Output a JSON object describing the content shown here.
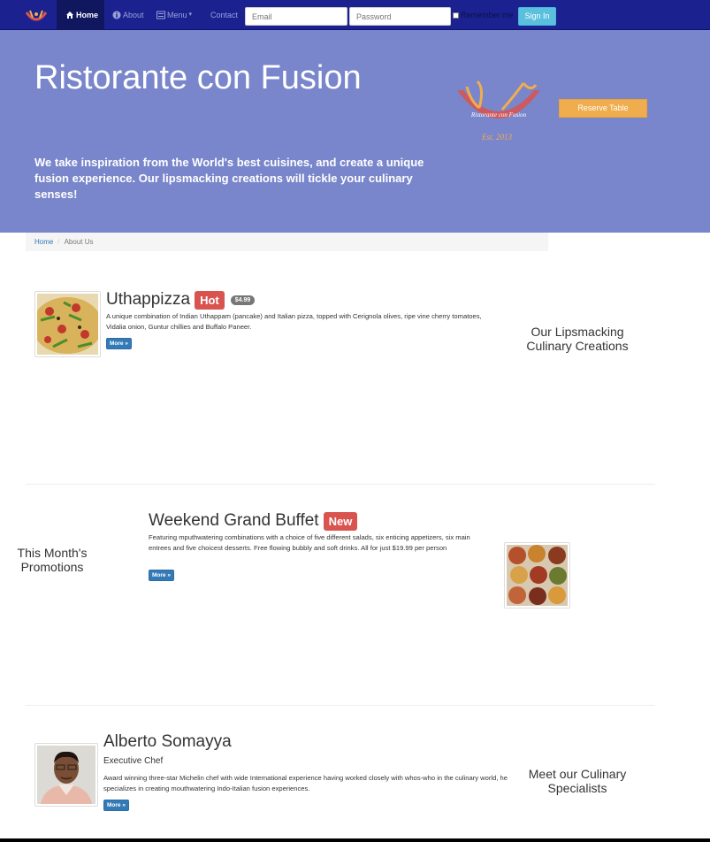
{
  "navbar": {
    "logo_icon": "restaurant-logo-icon",
    "items": [
      {
        "label": "Home",
        "icon": "home-icon",
        "active": true
      },
      {
        "label": "About",
        "icon": "info-icon",
        "active": false
      },
      {
        "label": "Menu",
        "icon": "list-icon",
        "active": false
      },
      {
        "label": "Contact",
        "icon": "",
        "active": false
      }
    ],
    "email_placeholder": "Email",
    "password_placeholder": "Password",
    "remember_label": "Remember me",
    "signin_label": "Sign In"
  },
  "jumbotron": {
    "title": "Ristorante con Fusion",
    "text": "We take inspiration from the World's best cuisines, and create a unique fusion experience. Our lipsmacking creations will tickle your culinary senses!",
    "logo_text": "Ristorante con Fusion",
    "logo_est": "Est. 2013",
    "reserve_label": "Reserve Table"
  },
  "breadcrumb": {
    "home": "Home",
    "current": "About Us"
  },
  "dish": {
    "name": "Uthappizza",
    "label": "Hot",
    "price": "$4.99",
    "description": "A unique combination of Indian Uthappam (pancake) and Italian pizza, topped with Cerignola olives, ripe vine cherry tomatoes, Vidalia onion, Guntur chillies and Buffalo Paneer.",
    "more_label": "More »",
    "side_text": "Our Lipsmacking Culinary Creations",
    "image_icon": "pizza-image"
  },
  "promotion": {
    "name": "Weekend Grand Buffet",
    "label": "New",
    "description": "Featuring mputhwatering combinations with a choice of five different salads, six enticing appetizers, six main entrees and five choicest desserts. Free flowing bubbly and soft drinks. All for just $19.99 per person",
    "more_label": "More »",
    "side_text": "This Month's Promotions",
    "image_icon": "buffet-image"
  },
  "leader": {
    "name": "Alberto Somayya",
    "designation": "Executive Chef",
    "description": "Award winning three-star Michelin chef with wide International experience having worked closely with whos-who in the culinary world, he specializes in creating mouthwatering Indo-Italian fusion experiences.",
    "more_label": "More »",
    "side_text": "Meet our Culinary Specialists",
    "image_icon": "chef-portrait-image"
  },
  "colors": {
    "navbar": "#1b2290",
    "jumbotron": "#7986cb",
    "danger": "#d9534f",
    "primary": "#337ab7",
    "warning": "#f0ad4e",
    "info": "#5bc0de"
  }
}
